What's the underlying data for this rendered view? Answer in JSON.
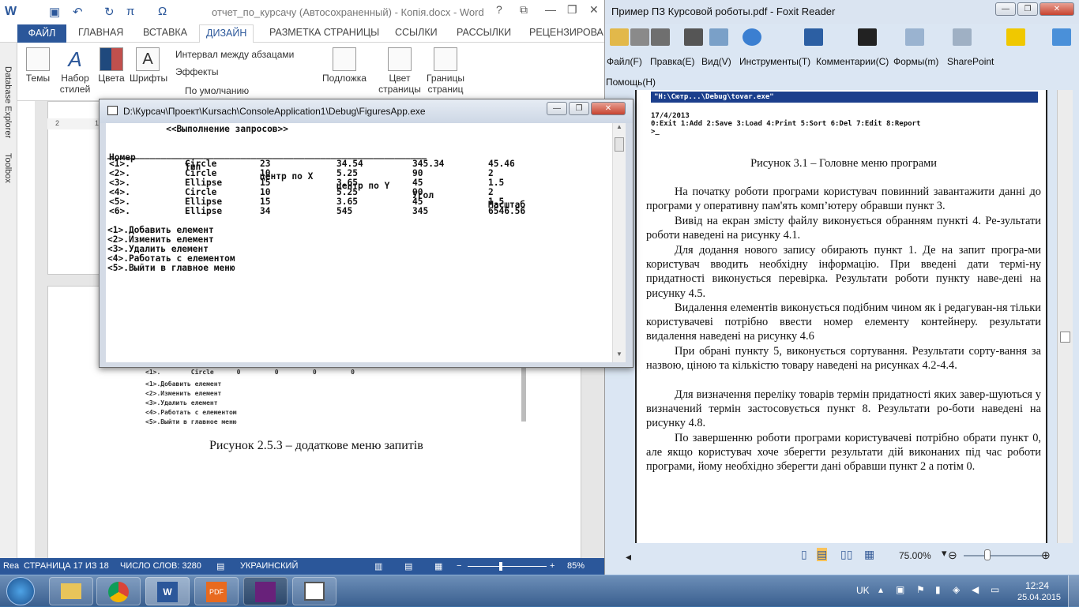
{
  "word": {
    "title": "отчет_по_курсачу (Автосохраненный) - Копія.docx - Word",
    "window_controls": {
      "help": "?",
      "ribbon_display": "⧉",
      "minimize": "—",
      "maximize": "❐",
      "close": "✕"
    },
    "tabs": [
      "ФАЙЛ",
      "ГЛАВНАЯ",
      "ВСТАВКА",
      "ДИЗАЙН",
      "РАЗМЕТКА СТРАНИЦЫ",
      "ССЫЛКИ",
      "РАССЫЛКИ",
      "РЕЦЕНЗИРОВА"
    ],
    "active_tab": "ДИЗАЙН",
    "ribbon": {
      "themes": "Темы",
      "style_set_line1": "Набор",
      "style_set_line2": "стилей",
      "colors": "Цвета",
      "fonts": "Шрифты",
      "paragraph_spacing": "Интервал между абзацами",
      "effects": "Эффекты",
      "set_default": "По умолчанию",
      "watermark": "Подложка",
      "page_color_line1": "Цвет",
      "page_color_line2": "страницы",
      "page_borders_line1": "Границы",
      "page_borders_line2": "страниц"
    },
    "side_panes": [
      "Database Explorer",
      "Toolbox"
    ],
    "ruler_marks": [
      "2",
      "1"
    ],
    "figure_caption": "Рисунок 2.5.3 – додаткове меню запитів",
    "doc_screenshot_lines": [
      "<1>.        Circle      0         0         0         0",
      "<1>.Добавить елемент",
      "<2>.Изменить елемент",
      "<3>.Удалить елемент",
      "<4>.Работать с елементом",
      "<5>.Выйти в главное меню"
    ],
    "status": {
      "left_cut": "Rea",
      "page": "СТРАНИЦА 17 ИЗ 18",
      "words": "ЧИСЛО СЛОВ: 3280",
      "language": "УКРАИНСКИЙ",
      "zoom": "85%"
    }
  },
  "console": {
    "title": "D:\\Курсач\\Проект\\Kursach\\ConsoleApplication1\\Debug\\FiguresApp.exe",
    "header_line": "           <<Выполнение запросов>>",
    "columns": [
      "Номер",
      "Тип",
      "центр по X",
      "центр по Y",
      "Угол",
      "Масштаб"
    ],
    "separator": "____________________________________________________________",
    "rows": [
      [
        "<1>.",
        "Circle",
        "23",
        "34.54",
        "345.34",
        "45.46"
      ],
      [
        "<2>.",
        "Circle",
        "10",
        "5.25",
        "90",
        "2"
      ],
      [
        "<3>.",
        "Ellipse",
        "15",
        "3.65",
        "45",
        "1.5"
      ],
      [
        "<4>.",
        "Circle",
        "10",
        "5.25",
        "90",
        "2"
      ],
      [
        "<5>.",
        "Ellipse",
        "15",
        "3.65",
        "45",
        "1.5"
      ],
      [
        "<6>.",
        "Ellipse",
        "34",
        "545",
        "345",
        "6546.56"
      ]
    ],
    "menu": [
      "<1>.Добавить елемент",
      "<2>.Изменить елемент",
      "<3>.Удалить елемент",
      "<4>.Работать с елементом",
      "<5>.Выйти в главное меню"
    ]
  },
  "foxit": {
    "title": "Пример ПЗ Курсовой роботы.pdf - Foxit Reader",
    "menu": [
      "Файл(F)",
      "Правка(E)",
      "Вид(V)",
      "Инструменты(T)",
      "Комментарии(C)",
      "Формы(m)",
      "SharePoint",
      "Помощь(H)"
    ],
    "pdf_shot": {
      "title": "\"H:\\Сютр...\\Debug\\tovar.exe\"",
      "date": "17/4/2013",
      "menu": "0:Exit 1:Add 2:Save 3:Load 4:Print 5:Sort 6:Del 7:Edit 8:Report",
      "prompt": ">_"
    },
    "caption": "Рисунок 3.1 – Головне меню програми",
    "paragraphs": [
      "На початку роботи програми користувач повинний завантажити данні до програми у оперативну пам'ять комп’ютеру обравши пункт 3.",
      "Вивід на екран змісту  файлу виконується обранням пункті 4. Ре-зультати роботи наведені на рисунку 4.1.",
      "Для додання нового запису обирають пункт 1. Де на запит програ-ми користувач вводить необхідну інформацію. При введені дати термі-ну придатності виконується перевірка. Результати роботи пункту наве-дені на рисунку 4.5.",
      "Видалення елементів виконується подібним чином як і редагуван-ня тільки користувачеві потрібно ввести номер елементу контейнеру. результати видалення наведені на рисунку  4.6",
      "При обрані пункту 5, виконується сортування. Результати сорту-вання за назвою, ціною та кількістю товару наведені на рисунках 4.2-4.4.",
      "Для визначення переліку товарів термін придатності яких завер-шуються у визначений термін застосовується пункт  8. Результати ро-боти  наведені на рисунку 4.8.",
      "По завершенню роботи програми користувачеві потрібно обрати пункт 0, але якщо користувач хоче зберегти результати дій виконаних під час роботи програми, йому необхідно зберегти дані обравши пункт 2 а потім 0."
    ],
    "zoom": "75.00%"
  },
  "taskbar": {
    "language": "UK",
    "time": "12:24",
    "date": "25.04.2015"
  },
  "colors": {
    "word_blue": "#2b579a",
    "console_bg": "#ffffff",
    "foxit_bg": "#dbe6f3",
    "taskbar": "#3a5f8f"
  }
}
